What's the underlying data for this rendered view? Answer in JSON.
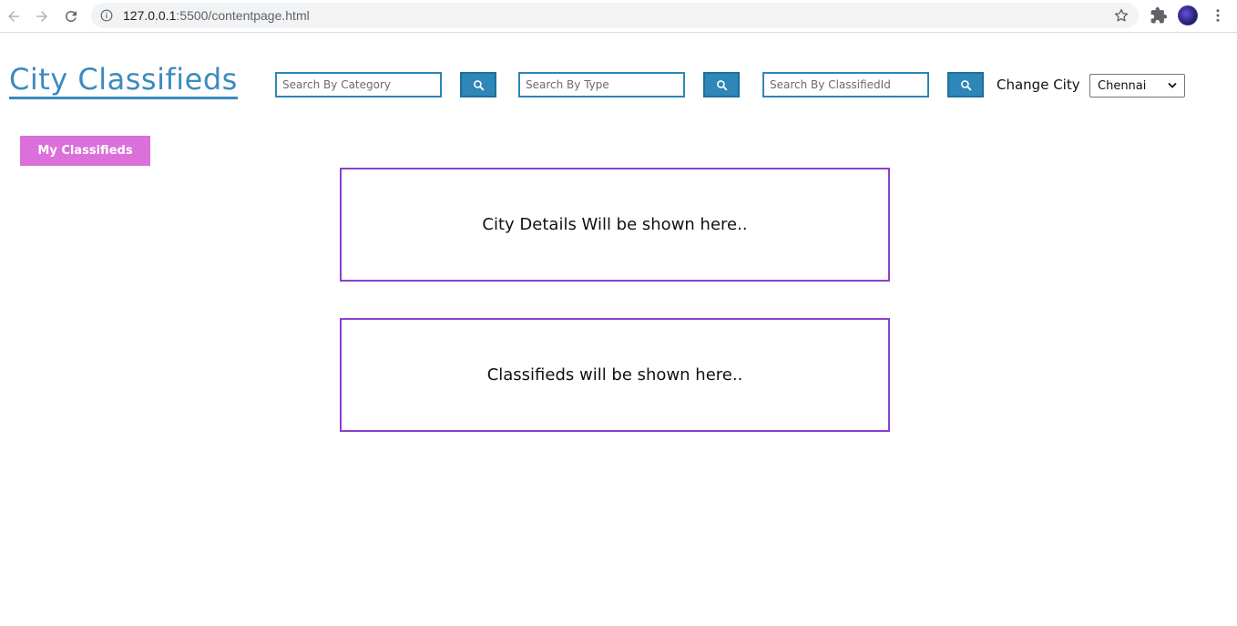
{
  "browser": {
    "url_host": "127.0.0.1",
    "url_path": ":5500/contentpage.html",
    "icons": [
      "back-arrow-icon",
      "forward-arrow-icon",
      "reload-icon",
      "info-icon",
      "star-icon",
      "puzzle-icon",
      "avatar",
      "menu-dots-icon"
    ]
  },
  "header": {
    "brand": "City Classifieds",
    "search_category_placeholder": "Search By Category",
    "search_type_placeholder": "Search By Type",
    "search_classified_placeholder": "Search By ClassifiedId",
    "change_city_label": "Change City",
    "selected_city": "Chennai"
  },
  "sidebar": {
    "my_classifieds_label": "My Classifieds"
  },
  "main": {
    "city_details_text": "City Details Will be shown here..",
    "classifieds_text": "Classifieds will be shown here.."
  },
  "colors": {
    "brand": "#3b8bbd",
    "search_button": "#2f86b8",
    "my_classifieds_button": "#db70db",
    "panel_border": "#8a3fd1"
  }
}
